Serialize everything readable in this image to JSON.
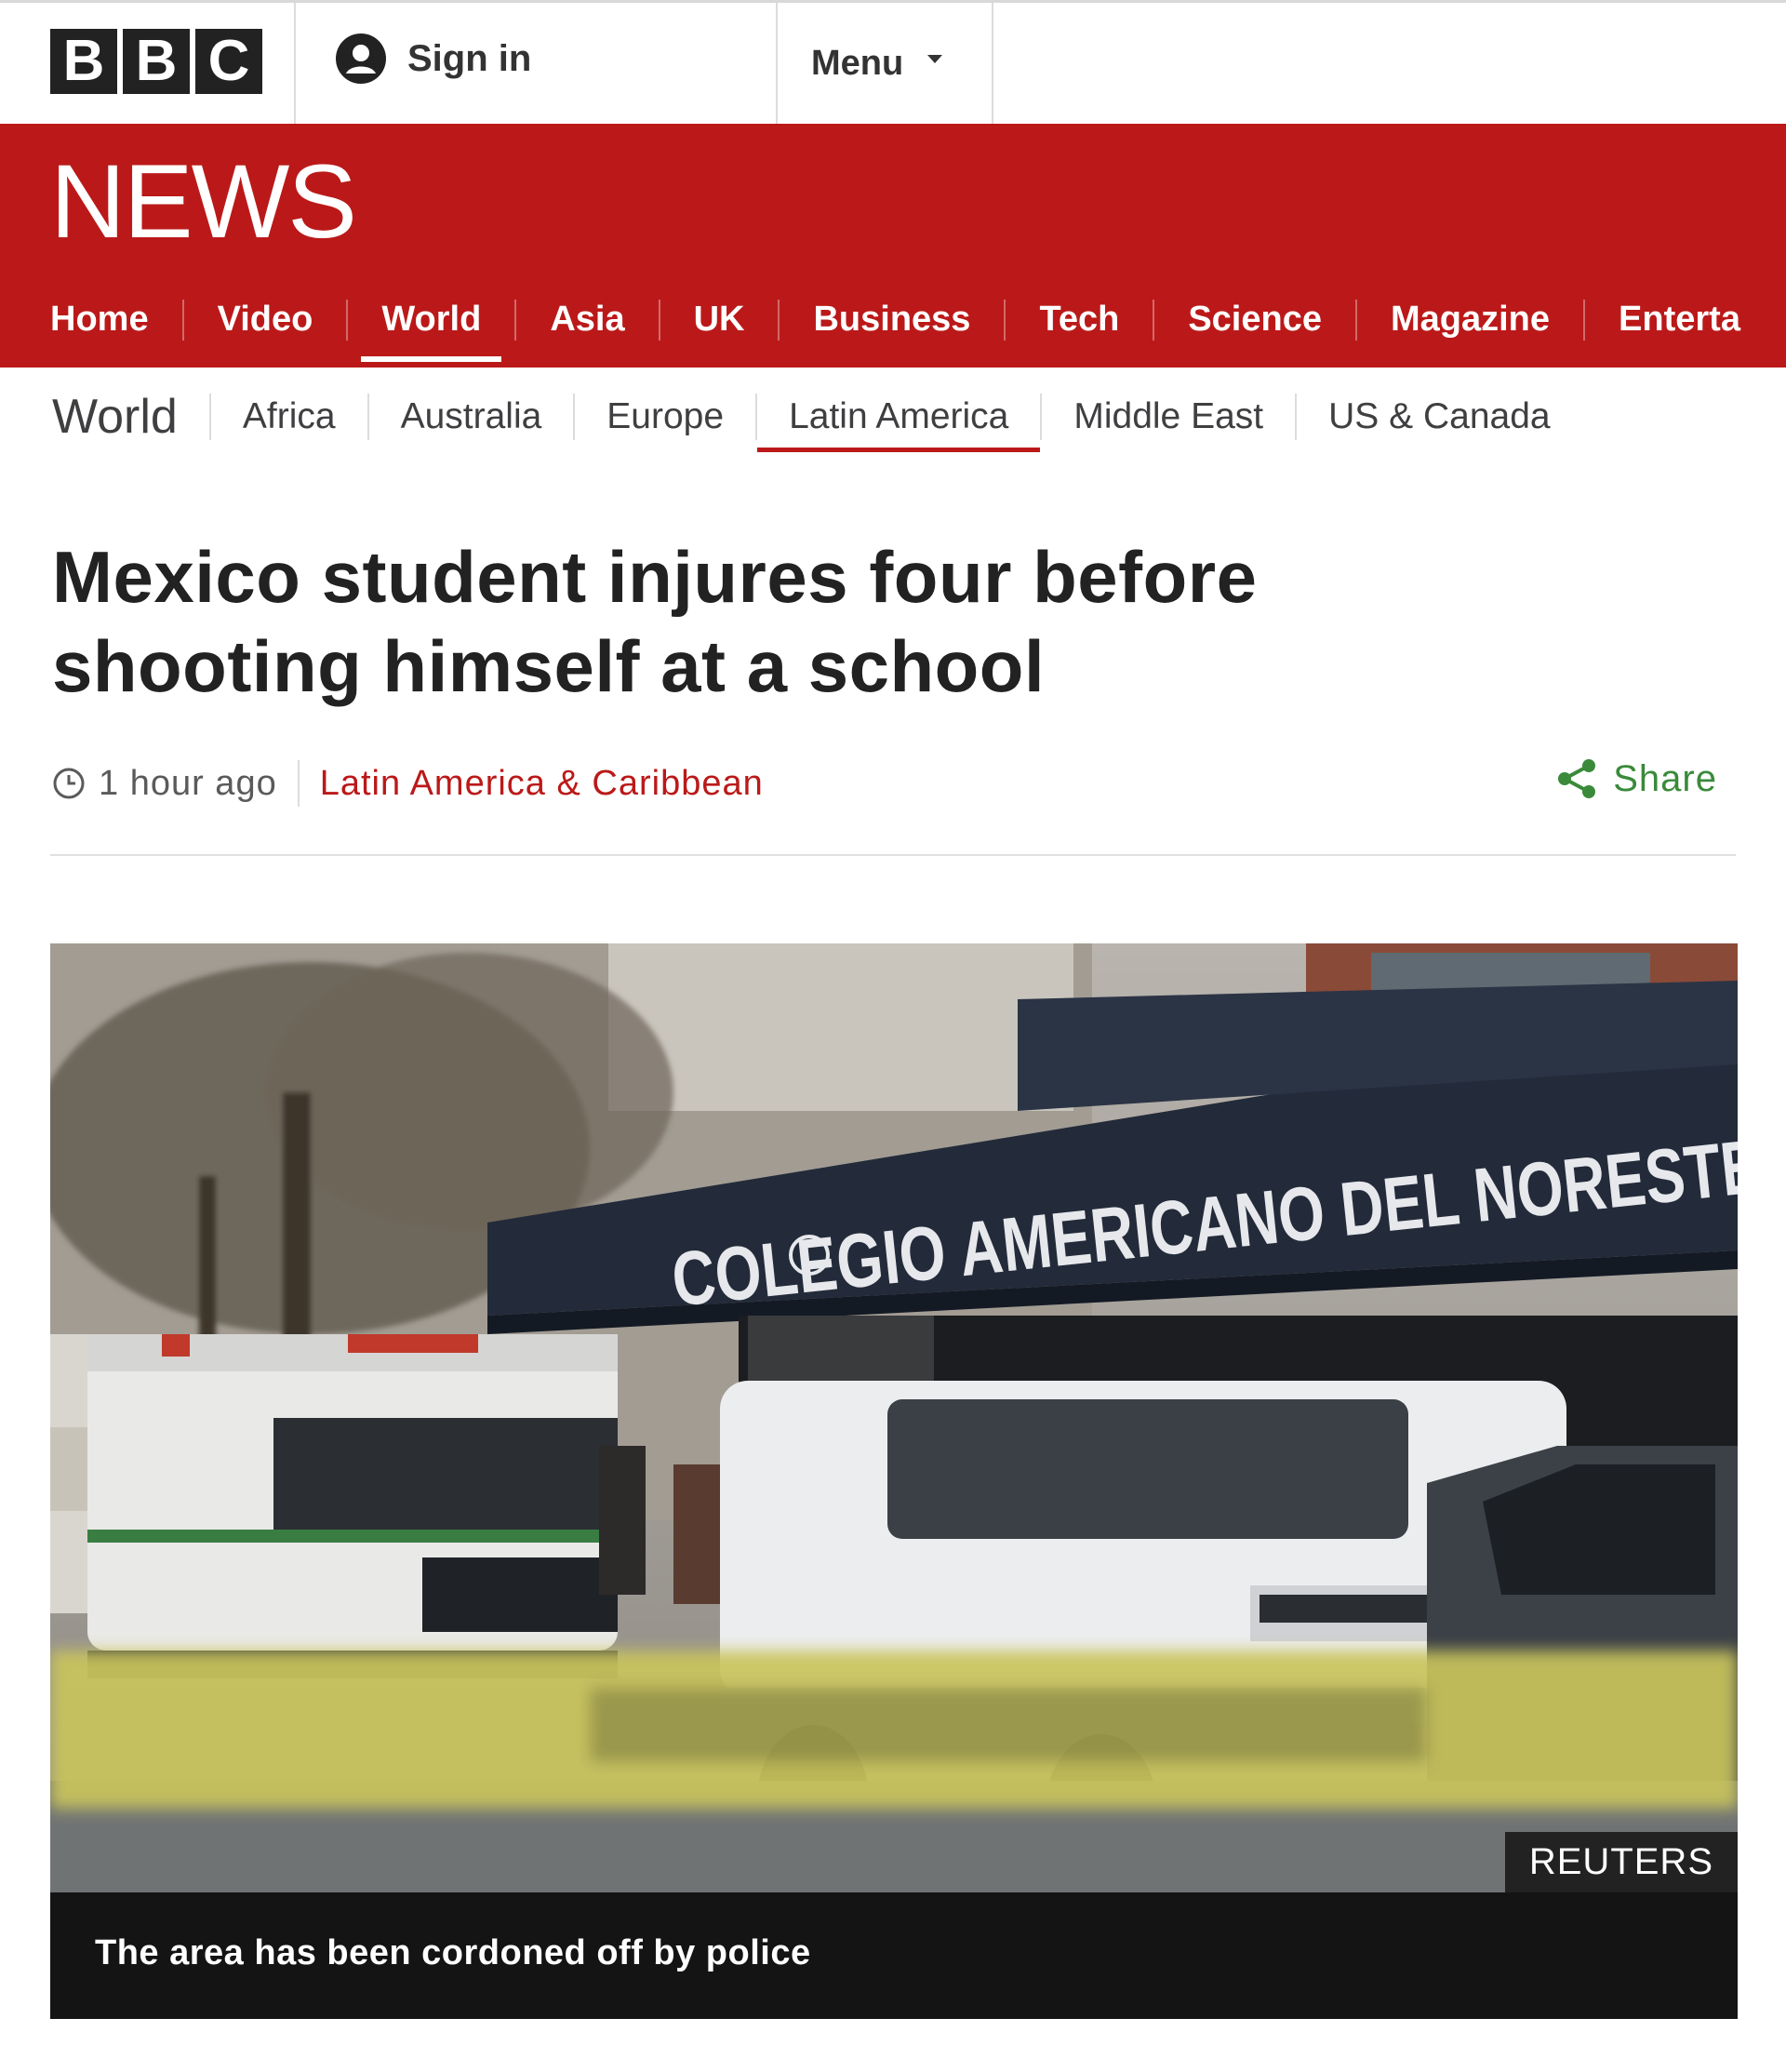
{
  "topbar": {
    "logo_letters": [
      "B",
      "B",
      "C"
    ],
    "signin_label": "Sign in",
    "menu_label": "Menu"
  },
  "brand": {
    "news_label": "NEWS",
    "color": "#bb1919"
  },
  "main_nav": {
    "items": [
      "Home",
      "Video",
      "World",
      "Asia",
      "UK",
      "Business",
      "Tech",
      "Science",
      "Magazine",
      "Enterta"
    ],
    "active": "World"
  },
  "sub_nav": {
    "section": "World",
    "items": [
      "Africa",
      "Australia",
      "Europe",
      "Latin America",
      "Middle East",
      "US & Canada"
    ],
    "active": "Latin America"
  },
  "article": {
    "headline_line1": "Mexico student injures four before",
    "headline_line2": "shooting himself at a school",
    "time_ago": "1 hour ago",
    "topic": "Latin America & Caribbean",
    "share_label": "Share"
  },
  "image": {
    "awning_text": "COLEGIO AMERICANO DEL NORESTE",
    "credit": "REUTERS",
    "caption": "The area has been cordoned off by police"
  },
  "icons": [
    "user-icon",
    "chevron-down-icon",
    "clock-icon",
    "share-icon"
  ]
}
